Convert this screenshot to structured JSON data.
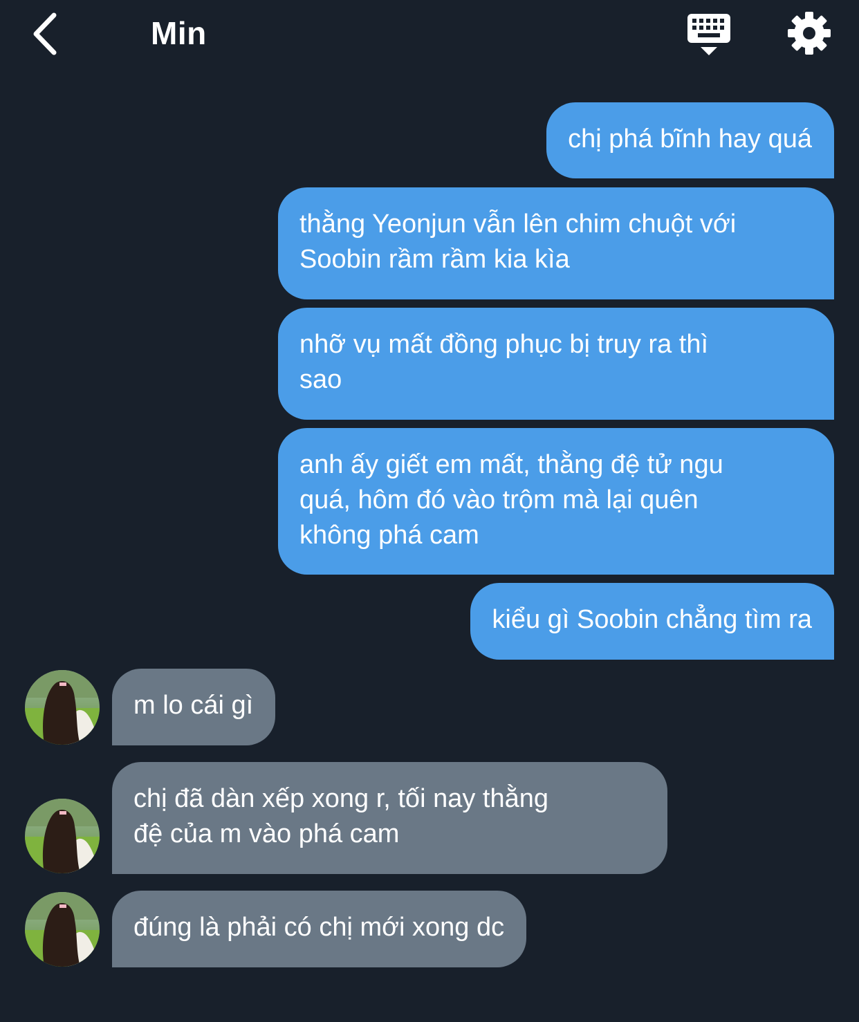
{
  "header": {
    "contact_name": "Min",
    "icons": [
      "chevron-left-icon",
      "keyboard-icon",
      "gear-icon"
    ]
  },
  "messages": [
    {
      "side": "outgoing",
      "text": "chị phá bĩnh hay quá"
    },
    {
      "side": "outgoing",
      "text": "thằng Yeonjun vẫn lên chim chuột với\nSoobin rầm rầm kia kìa"
    },
    {
      "side": "outgoing",
      "text": "nhỡ vụ mất đồng phục bị truy ra thì\nsao"
    },
    {
      "side": "outgoing",
      "text": "anh ấy giết em mất, thằng đệ tử ngu\nquá, hôm đó vào trộm mà lại quên\nkhông phá cam"
    },
    {
      "side": "outgoing",
      "text": "kiểu gì Soobin chẳng tìm ra"
    },
    {
      "side": "incoming",
      "text": "m lo cái gì"
    },
    {
      "side": "incoming",
      "text": "chị đã dàn xếp xong r, tối nay thằng\nđệ của m vào phá cam"
    },
    {
      "side": "incoming",
      "text": "đúng là phải có chị mới xong dc"
    }
  ],
  "colors": {
    "background": "#18202b",
    "outgoing_bubble": "#4b9de8",
    "incoming_bubble": "#6a7886",
    "text": "#ffffff"
  }
}
